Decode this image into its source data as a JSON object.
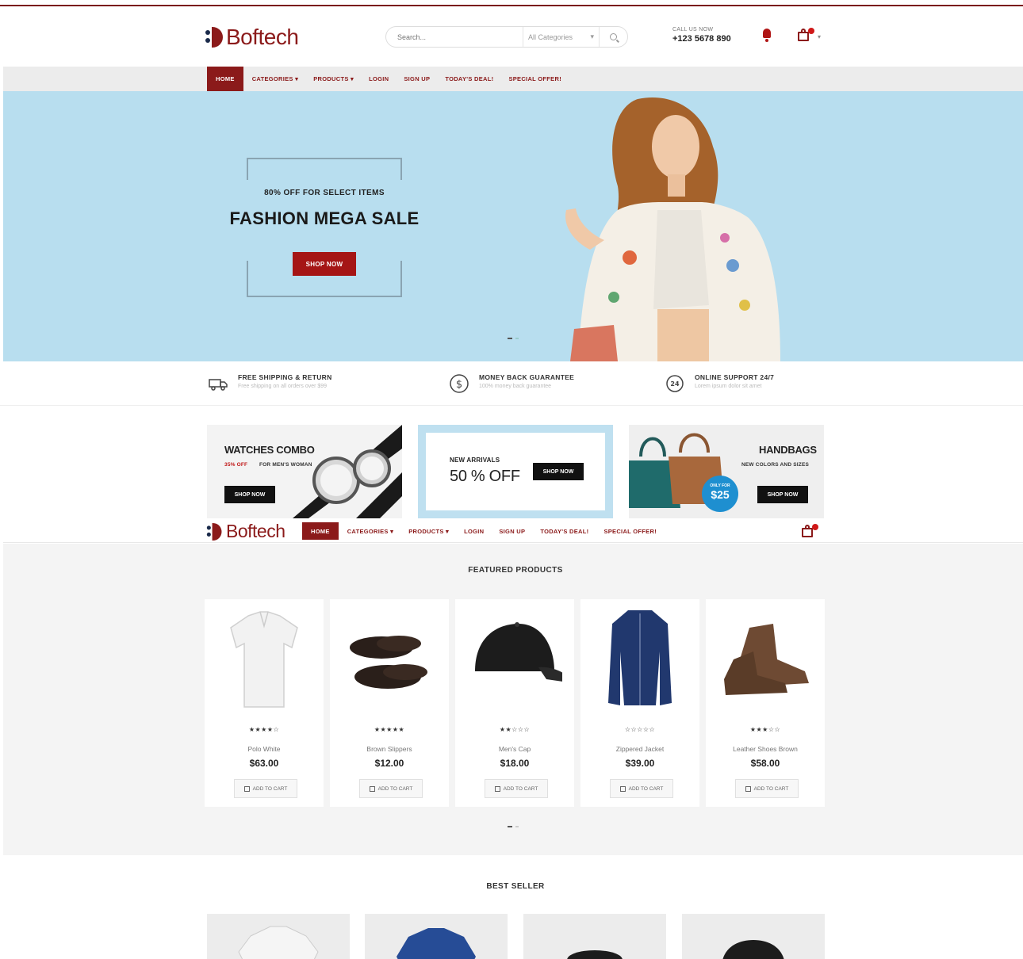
{
  "brand": {
    "name": "Boftech"
  },
  "search": {
    "placeholder": "Search...",
    "category": "All Categories"
  },
  "contact": {
    "label": "CALL US NOW",
    "phone": "+123 5678 890"
  },
  "nav": {
    "items": [
      {
        "label": "HOME",
        "active": true
      },
      {
        "label": "CATEGORIES ▾"
      },
      {
        "label": "PRODUCTS ▾"
      },
      {
        "label": "LOGIN"
      },
      {
        "label": "SIGN UP"
      },
      {
        "label": "TODAY'S DEAL!"
      },
      {
        "label": "SPECIAL OFFER!"
      }
    ]
  },
  "hero": {
    "subtitle": "80% OFF FOR SELECT ITEMS",
    "title": "FASHION MEGA SALE",
    "button": "SHOP NOW"
  },
  "features": [
    {
      "title": "FREE SHIPPING & RETURN",
      "desc": "Free shipping on all orders over $99",
      "icon": "truck-icon"
    },
    {
      "title": "MONEY BACK GUARANTEE",
      "desc": "100% money back guarantee",
      "icon": "dollar-icon"
    },
    {
      "title": "ONLINE SUPPORT 24/7",
      "desc": "Lorem ipsum dolor sit amet",
      "icon": "support-24-icon"
    }
  ],
  "banners": {
    "watches": {
      "title": "WATCHES COMBO",
      "discount": "35% OFF",
      "sub": "FOR MEN'S WOMAN",
      "button": "SHOP NOW"
    },
    "arrivals": {
      "title": "NEW ARRIVALS",
      "big": "50 % OFF",
      "button": "SHOP NOW"
    },
    "handbags": {
      "title": "HANDBAGS",
      "sub": "NEW COLORS AND SIZES",
      "badge_top": "ONLY FOR",
      "badge_price": "$25",
      "button": "SHOP NOW"
    }
  },
  "featured": {
    "title": "FEATURED PRODUCTS",
    "add_label": "ADD TO CART",
    "products": [
      {
        "name": "Polo White",
        "price": "$63.00",
        "stars": "★★★★☆"
      },
      {
        "name": "Brown Slippers",
        "price": "$12.00",
        "stars": "★★★★★"
      },
      {
        "name": "Men's Cap",
        "price": "$18.00",
        "stars": "★★☆☆☆"
      },
      {
        "name": "Zippered Jacket",
        "price": "$39.00",
        "stars": "☆☆☆☆☆"
      },
      {
        "name": "Leather Shoes Brown",
        "price": "$58.00",
        "stars": "★★★☆☆"
      }
    ]
  },
  "best_seller": {
    "title": "BEST SELLER"
  },
  "colors": {
    "brand": "#8b1a1a",
    "accent": "#a51515",
    "hero_bg": "#b8deef",
    "badge": "#1e8fd0"
  }
}
